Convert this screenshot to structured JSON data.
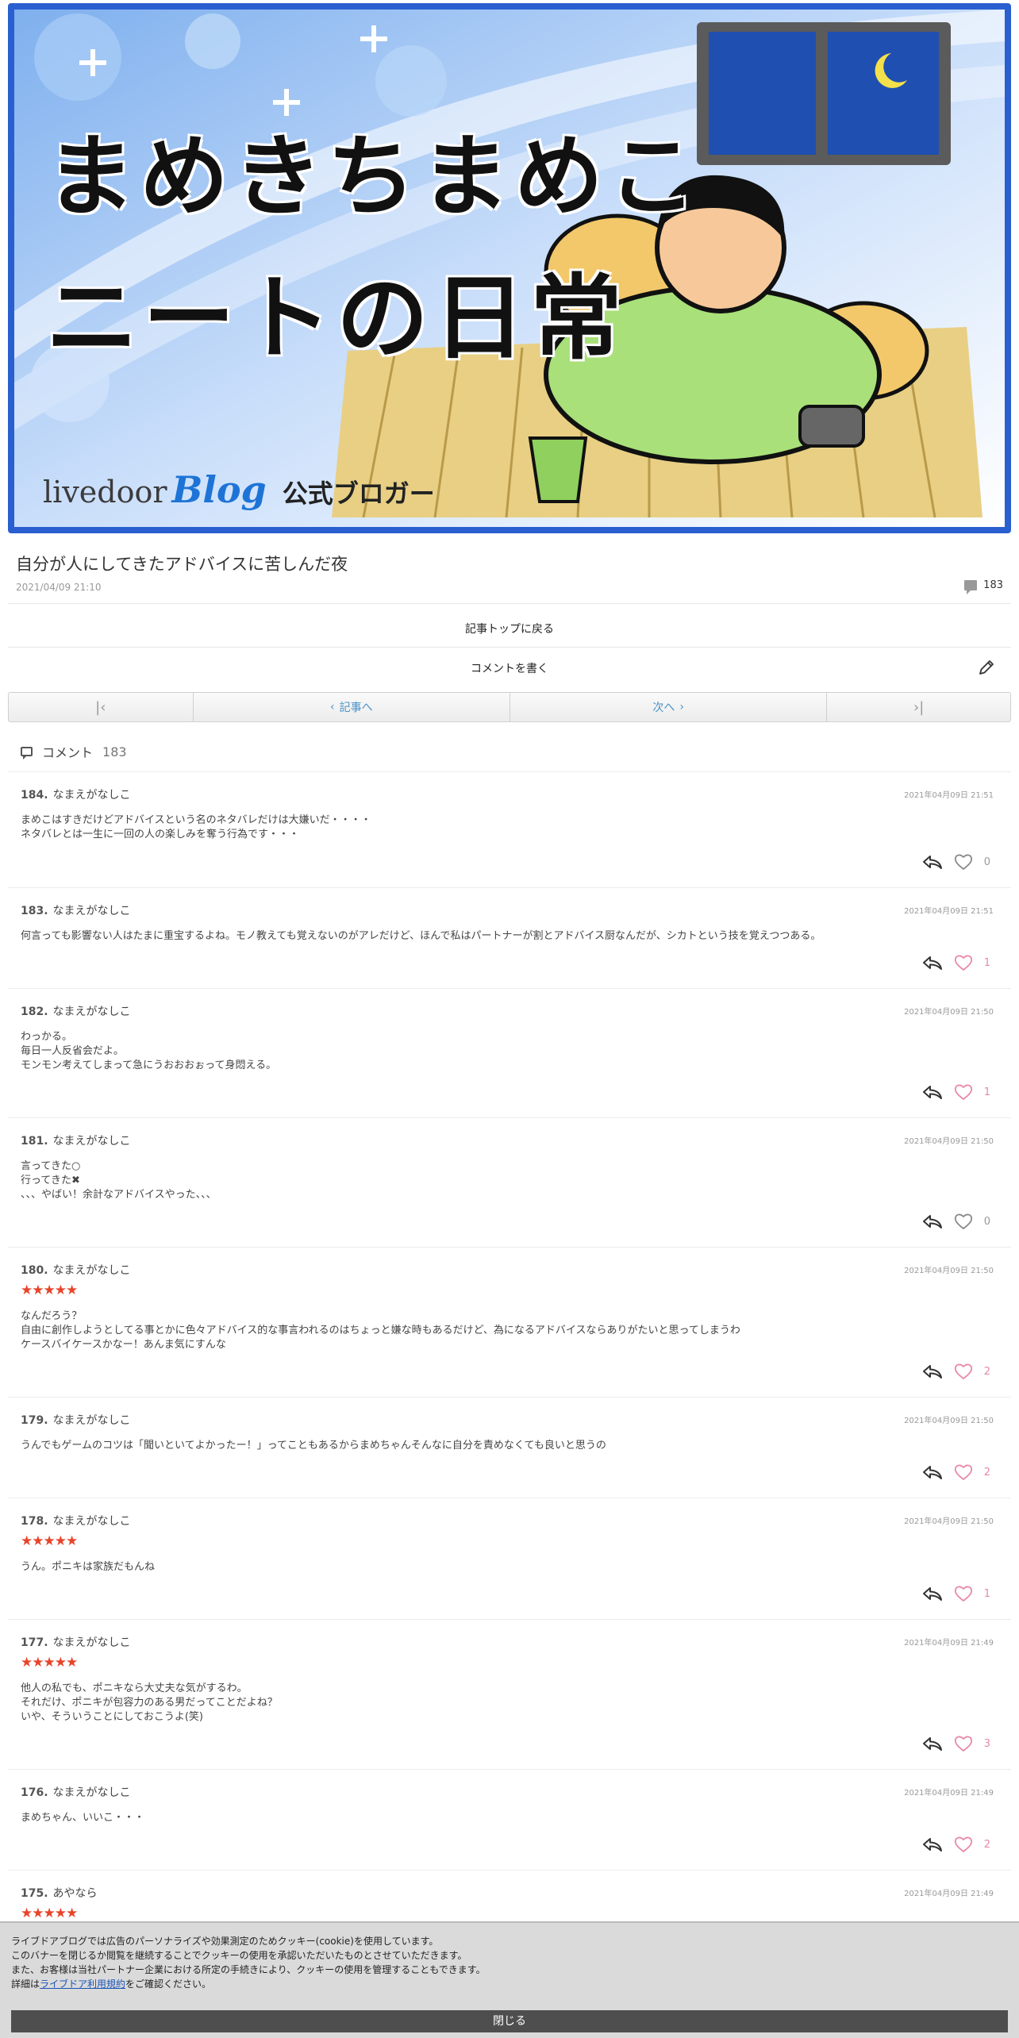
{
  "header": {
    "title_line1": "まめきちまめこ",
    "title_line2": "ニートの日常",
    "brand_livedoor": "livedoor",
    "brand_blog": "Blog",
    "brand_official": "公式ブロガー"
  },
  "article": {
    "title": "自分が人にしてきたアドバイスに苦しんだ夜",
    "date": "2021/04/09 21:10",
    "comment_count": "183",
    "back_to_top": "記事トップに戻る",
    "write_comment": "コメントを書く"
  },
  "pager": {
    "prev_label": "記事へ",
    "next_label": "次へ"
  },
  "comments_section": {
    "label": "コメント",
    "count": "183"
  },
  "comments": [
    {
      "no": "184.",
      "name": "なまえがなしこ",
      "date": "2021年04月09日 21:51",
      "stars": "",
      "body": "まめこはすきだけどアドバイスという名のネタバレだけは大嫌いだ・・・・\nネタバレとは一生に一回の人の楽しみを奪う行為です・・・",
      "likes": "0"
    },
    {
      "no": "183.",
      "name": "なまえがなしこ",
      "date": "2021年04月09日 21:51",
      "stars": "",
      "body": "何言っても影響ない人はたまに重宝するよね。モノ教えても覚えないのがアレだけど、ほんで私はパートナーが割とアドバイス厨なんだが、シカトという技を覚えつつある。",
      "likes": "1"
    },
    {
      "no": "182.",
      "name": "なまえがなしこ",
      "date": "2021年04月09日 21:50",
      "stars": "",
      "body": "わっかる。\n毎日一人反省会だよ。\nモンモン考えてしまって急にうおおおぉって身悶える。",
      "likes": "1"
    },
    {
      "no": "181.",
      "name": "なまえがなしこ",
      "date": "2021年04月09日 21:50",
      "stars": "",
      "body": "言ってきた○\n行ってきた✖\n、、、やばい！余計なアドバイスやった、、、",
      "likes": "0"
    },
    {
      "no": "180.",
      "name": "なまえがなしこ",
      "date": "2021年04月09日 21:50",
      "stars": "★★★★★",
      "body": "なんだろう？\n自由に創作しようとしてる事とかに色々アドバイス的な事言われるのはちょっと嫌な時もあるだけど、為になるアドバイスならありがたいと思ってしまうわ\nケースバイケースかなー！あんま気にすんな",
      "likes": "2"
    },
    {
      "no": "179.",
      "name": "なまえがなしこ",
      "date": "2021年04月09日 21:50",
      "stars": "",
      "body": "うんでもゲームのコツは「聞いといてよかったー！」ってこともあるからまめちゃんそんなに自分を責めなくても良いと思うの",
      "likes": "2"
    },
    {
      "no": "178.",
      "name": "なまえがなしこ",
      "date": "2021年04月09日 21:50",
      "stars": "★★★★★",
      "body": "うん。ポニキは家族だもんね",
      "likes": "1"
    },
    {
      "no": "177.",
      "name": "なまえがなしこ",
      "date": "2021年04月09日 21:49",
      "stars": "★★★★★",
      "body": "他人の私でも、ポニキなら大丈夫な気がするわ。\nそれだけ、ポニキが包容力のある男だってことだよね？\nいや、そういうことにしておこうよ(笑)",
      "likes": "3"
    },
    {
      "no": "176.",
      "name": "なまえがなしこ",
      "date": "2021年04月09日 21:49",
      "stars": "",
      "body": "まめちゃん、いいこ・・・",
      "likes": "2"
    },
    {
      "no": "175.",
      "name": "あやなら",
      "date": "2021年04月09日 21:49",
      "stars": "★★★★★",
      "body": "",
      "likes": ""
    }
  ],
  "cookie": {
    "line1": "ライブドアブログでは広告のパーソナライズや効果測定のためクッキー(cookie)を使用しています。",
    "line2": "このバナーを閉じるか閲覧を継続することでクッキーの使用を承認いただいたものとさせていただきます。",
    "line3": "また、お客様は当社パートナー企業における所定の手続きにより、クッキーの使用を管理することもできます。",
    "line4_prefix": "詳細は",
    "line4_link": "ライブドア利用規約",
    "line4_suffix": "をご確認ください。",
    "close_label": "閉じる"
  },
  "colors": {
    "accent_link": "#4a93c9",
    "star": "#e8442a",
    "heart_liked": "#e888a6",
    "banner_border": "#2a5fd0"
  }
}
